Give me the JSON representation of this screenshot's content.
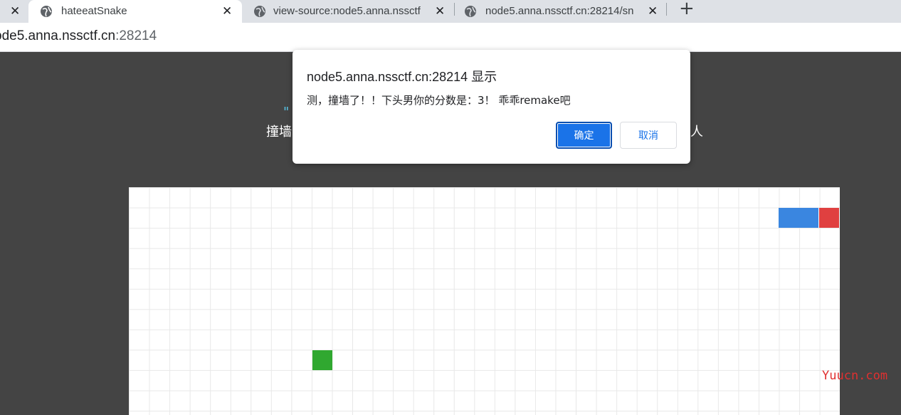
{
  "tabs": [
    {
      "label": "hateeatSnake",
      "active": true
    },
    {
      "label": "view-source:node5.anna.nssctf",
      "active": false
    },
    {
      "label": "node5.anna.nssctf.cn:28214/sn",
      "active": false
    }
  ],
  "newtab_label": "+",
  "close_glyph": "✕",
  "address": {
    "host": "ode5.anna.nssctf.cn",
    "port": ":28214"
  },
  "page": {
    "hint_top_fragment": "\"",
    "hint_left_fragment": "撞墙",
    "hint_right_fragment": "人"
  },
  "dialog": {
    "title": "node5.anna.nssctf.cn:28214 显示",
    "message": "测，撞墙了！！下头男你的分数是：3！ 乖乖remake吧",
    "ok_label": "确定",
    "cancel_label": "取消"
  },
  "game": {
    "snake_body_color": "#3a86e0",
    "snake_head_color": "#e04040",
    "food_color": "#30a830"
  },
  "watermark": "Yuucn.com"
}
